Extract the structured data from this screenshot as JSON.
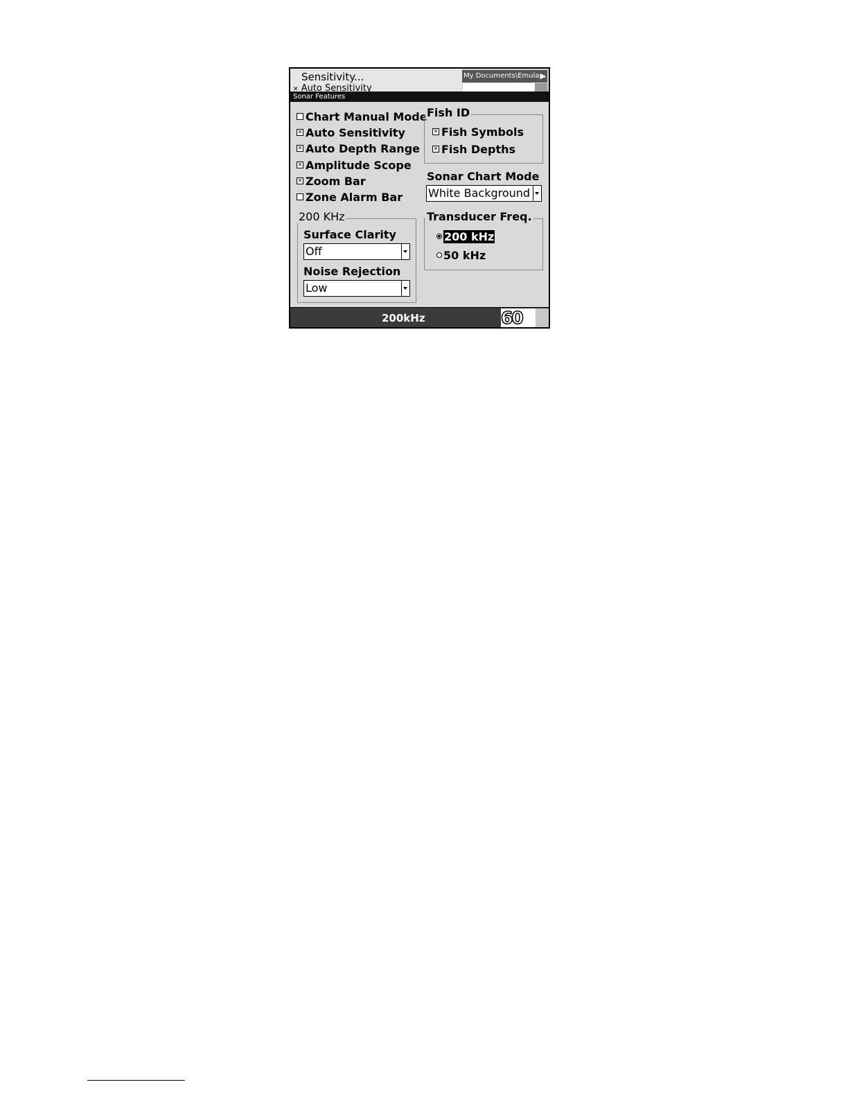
{
  "background_menu": {
    "item_1": "Sensitivity...",
    "item_2": "Auto Sensitivity",
    "path": "My Documents\\Emula...",
    "path_arrow": "▶"
  },
  "dialog": {
    "title": "Sonar Features",
    "checkboxes": [
      {
        "label": "Chart Manual Mode",
        "checked": false
      },
      {
        "label": "Auto Sensitivity",
        "checked": true
      },
      {
        "label": "Auto Depth Range",
        "checked": true
      },
      {
        "label": "Amplitude Scope",
        "checked": true
      },
      {
        "label": "Zoom Bar",
        "checked": true
      },
      {
        "label": "Zone Alarm Bar",
        "checked": false
      }
    ],
    "fish_id": {
      "label": "Fish ID",
      "items": [
        {
          "label": "Fish Symbols",
          "checked": true
        },
        {
          "label": "Fish Depths",
          "checked": true
        }
      ]
    },
    "sonar_chart_mode": {
      "label": "Sonar Chart Mode",
      "value": "White Background"
    },
    "freq_group": {
      "label": "200 KHz",
      "surface_clarity": {
        "label": "Surface Clarity",
        "value": "Off"
      },
      "noise_rejection": {
        "label": "Noise Rejection",
        "value": "Low"
      }
    },
    "transducer_freq": {
      "label": "Transducer Freq.",
      "options": [
        {
          "label": "200 kHz",
          "selected": true
        },
        {
          "label": "50 kHz",
          "selected": false
        }
      ]
    }
  },
  "status": {
    "frequency": "200kHz",
    "depth": "60"
  },
  "check_mark": "✕"
}
